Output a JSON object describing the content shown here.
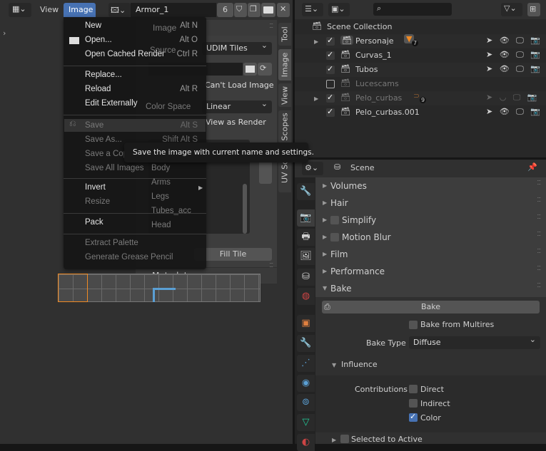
{
  "image_editor": {
    "header": {
      "menu_view": "View",
      "menu_image": "Image",
      "image_name": "Armor_1",
      "users": "6"
    },
    "sidebar_tabs": [
      "Tool",
      "Image",
      "View",
      "Scopes",
      "UV Squ"
    ],
    "image_panel": {
      "title": "Image",
      "source_label": "Source",
      "source_value": "UDIM Tiles",
      "status": "Can't Load Image",
      "color_space_label": "Color Space",
      "color_space_value": "Linear",
      "view_as_render": "View as Render",
      "tiles": [
        "Body",
        "Arms",
        "Legs",
        "Tubes_acc",
        "Head"
      ],
      "fill_tile": "Fill Tile",
      "metadata": "Metadata"
    },
    "image_menu": {
      "items": [
        {
          "label": "New",
          "shortcut": "Alt N"
        },
        {
          "label": "Open...",
          "shortcut": "Alt O"
        },
        {
          "label": "Open Cached Render",
          "shortcut": "Ctrl R"
        },
        {
          "label": "Replace...",
          "shortcut": ""
        },
        {
          "label": "Reload",
          "shortcut": "Alt R"
        },
        {
          "label": "Edit Externally",
          "shortcut": ""
        },
        {
          "label": "Save",
          "shortcut": "Alt S"
        },
        {
          "label": "Save As...",
          "shortcut": "Shift Alt S"
        },
        {
          "label": "Save a Copy...",
          "shortcut": ""
        },
        {
          "label": "Save All Images",
          "shortcut": ""
        },
        {
          "label": "Invert",
          "shortcut": ""
        },
        {
          "label": "Resize",
          "shortcut": ""
        },
        {
          "label": "Pack",
          "shortcut": ""
        },
        {
          "label": "Extract Palette",
          "shortcut": ""
        },
        {
          "label": "Generate Grease Pencil",
          "shortcut": ""
        }
      ]
    },
    "tooltip": "Save the image with current name and settings."
  },
  "outliner": {
    "root": "Scene Collection",
    "rows": [
      {
        "name": "Personaje",
        "checked": true,
        "badge": "7"
      },
      {
        "name": "Curvas_1",
        "checked": true
      },
      {
        "name": "Tubos",
        "checked": true
      },
      {
        "name": "Lucescams",
        "checked": false
      },
      {
        "name": "Pelo_curbas",
        "checked": true,
        "badge": "9"
      },
      {
        "name": "Pelo_curbas.001",
        "checked": true
      }
    ]
  },
  "properties": {
    "context": "Scene",
    "panels": [
      "Volumes",
      "Hair",
      "Simplify",
      "Motion Blur",
      "Film",
      "Performance",
      "Bake"
    ],
    "bake": {
      "button": "Bake",
      "from_multires": "Bake from Multires",
      "type_label": "Bake Type",
      "type_value": "Diffuse",
      "influence": "Influence",
      "contributions": "Contributions",
      "direct": "Direct",
      "indirect": "Indirect",
      "color": "Color",
      "selected_to_active": "Selected to Active"
    }
  },
  "colors": {
    "accent": "#4772b3",
    "highlight_orange": "#f08a24"
  }
}
